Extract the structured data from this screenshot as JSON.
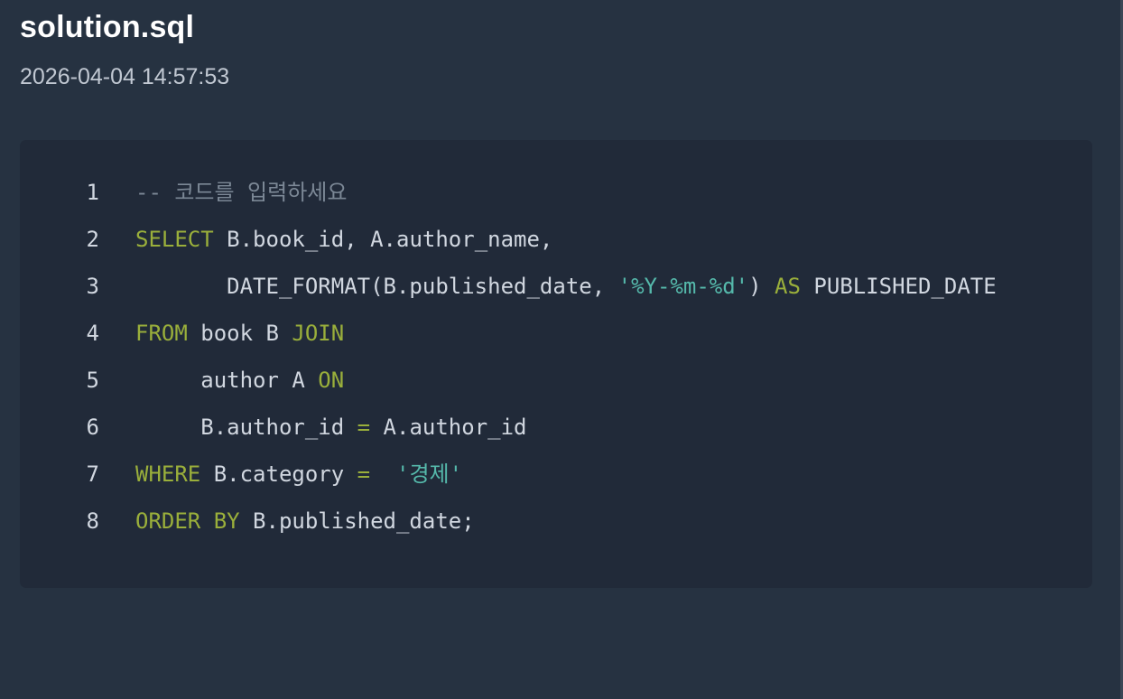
{
  "file": {
    "name": "solution.sql",
    "timestamp": "2026-04-04 14:57:53"
  },
  "colors": {
    "page_background": "#263241",
    "code_background": "#212a39",
    "plain_text": "#d1d7e0",
    "keyword": "#9aaf3b",
    "string": "#55b9ab",
    "comment": "#7c8896"
  },
  "code": {
    "language": "sql",
    "lines": [
      {
        "number": "1",
        "tokens": [
          {
            "type": "comment",
            "text": "-- 코드를 입력하세요"
          }
        ]
      },
      {
        "number": "2",
        "tokens": [
          {
            "type": "keyword",
            "text": "SELECT"
          },
          {
            "type": "plain",
            "text": " B.book_id, A.author_name,"
          }
        ]
      },
      {
        "number": "3",
        "tokens": [
          {
            "type": "plain",
            "text": "       DATE_FORMAT(B.published_date, "
          },
          {
            "type": "string",
            "text": "'%Y-%m-%d'"
          },
          {
            "type": "plain",
            "text": ") "
          },
          {
            "type": "keyword",
            "text": "AS"
          },
          {
            "type": "plain",
            "text": " PUBLISHED_DATE"
          }
        ]
      },
      {
        "number": "4",
        "tokens": [
          {
            "type": "keyword",
            "text": "FROM"
          },
          {
            "type": "plain",
            "text": " book B "
          },
          {
            "type": "keyword",
            "text": "JOIN"
          }
        ]
      },
      {
        "number": "5",
        "tokens": [
          {
            "type": "plain",
            "text": "     author A "
          },
          {
            "type": "keyword",
            "text": "ON"
          }
        ]
      },
      {
        "number": "6",
        "tokens": [
          {
            "type": "plain",
            "text": "     B.author_id "
          },
          {
            "type": "operator",
            "text": "="
          },
          {
            "type": "plain",
            "text": " A.author_id"
          }
        ]
      },
      {
        "number": "7",
        "tokens": [
          {
            "type": "keyword",
            "text": "WHERE"
          },
          {
            "type": "plain",
            "text": " B.category "
          },
          {
            "type": "operator",
            "text": "="
          },
          {
            "type": "plain",
            "text": "  "
          },
          {
            "type": "string",
            "text": "'경제'"
          }
        ]
      },
      {
        "number": "8",
        "tokens": [
          {
            "type": "keyword",
            "text": "ORDER BY"
          },
          {
            "type": "plain",
            "text": " B.published_date;"
          }
        ]
      }
    ]
  }
}
